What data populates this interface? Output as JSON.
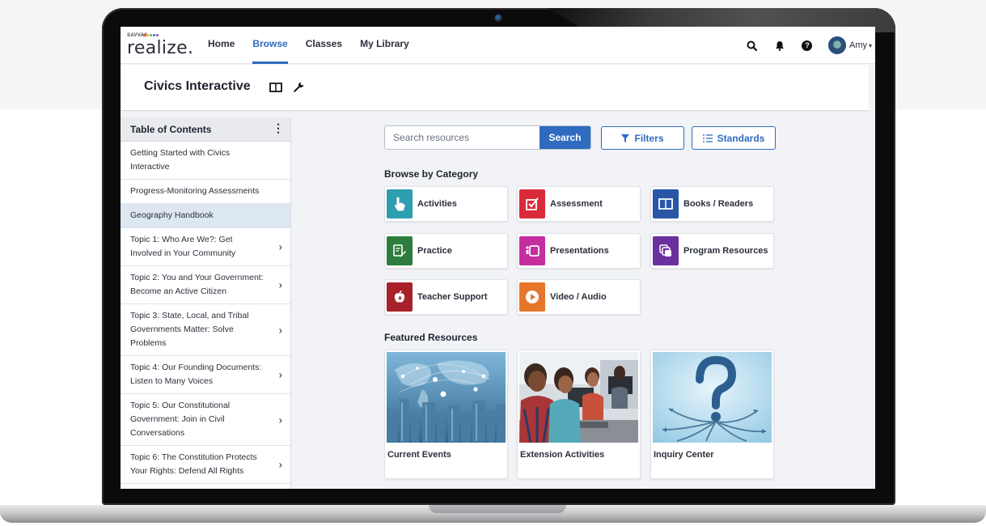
{
  "app": {
    "logo_small": "SAVVAS",
    "logo_text": "realize.",
    "nav": [
      {
        "label": "Home",
        "active": false
      },
      {
        "label": "Browse",
        "active": true
      },
      {
        "label": "Classes",
        "active": false
      },
      {
        "label": "My Library",
        "active": false
      }
    ],
    "header_icons": [
      "search-icon",
      "bell-icon",
      "help-icon",
      "avatar"
    ],
    "user": {
      "name": "Amy"
    }
  },
  "program": {
    "title": "Civics Interactive",
    "icons": [
      "book-icon",
      "wrench-icon"
    ]
  },
  "toc": {
    "title": "Table of Contents",
    "items": [
      {
        "label": "Getting Started with Civics Interactive",
        "has_children": false,
        "selected": false
      },
      {
        "label": "Progress-Monitoring Assessments",
        "has_children": false,
        "selected": false
      },
      {
        "label": "Geography Handbook",
        "has_children": false,
        "selected": true
      },
      {
        "label": "Topic 1: Who Are We?: Get Involved in Your Community",
        "has_children": true,
        "selected": false
      },
      {
        "label": "Topic 2: You and Your Government: Become an Active Citizen",
        "has_children": true,
        "selected": false
      },
      {
        "label": "Topic 3: State, Local, and Tribal Governments Matter: Solve Problems",
        "has_children": true,
        "selected": false
      },
      {
        "label": "Topic 4: Our Founding Documents: Listen to Many Voices",
        "has_children": true,
        "selected": false
      },
      {
        "label": "Topic 5: Our Constitutional Government: Join in Civil Conversations",
        "has_children": true,
        "selected": false
      },
      {
        "label": "Topic 6: The Constitution Protects Your Rights: Defend All Rights",
        "has_children": true,
        "selected": false
      }
    ]
  },
  "search": {
    "placeholder": "Search resources",
    "button": "Search",
    "filters": "Filters",
    "standards": "Standards"
  },
  "browse": {
    "title": "Browse by Category",
    "categories": [
      {
        "label": "Activities",
        "icon": "pointer-hand-icon",
        "color": "#2d9fb0"
      },
      {
        "label": "Assessment",
        "icon": "checkbox-icon",
        "color": "#d92b3a"
      },
      {
        "label": "Books / Readers",
        "icon": "open-book-icon",
        "color": "#2a56a8"
      },
      {
        "label": "Practice",
        "icon": "pencil-note-icon",
        "color": "#2e7d3e"
      },
      {
        "label": "Presentations",
        "icon": "presentation-icon",
        "color": "#c42e9e"
      },
      {
        "label": "Program Resources",
        "icon": "stack-icon",
        "color": "#6b2f9e"
      },
      {
        "label": "Teacher Support",
        "icon": "apple-icon",
        "color": "#a8202a"
      },
      {
        "label": "Video / Audio",
        "icon": "play-icon",
        "color": "#e6762a"
      }
    ]
  },
  "featured": {
    "title": "Featured Resources",
    "items": [
      {
        "label": "Current Events",
        "image": "world-map-city-image"
      },
      {
        "label": "Extension Activities",
        "image": "students-computers-image"
      },
      {
        "label": "Inquiry Center",
        "image": "question-mark-arrows-image"
      }
    ]
  }
}
